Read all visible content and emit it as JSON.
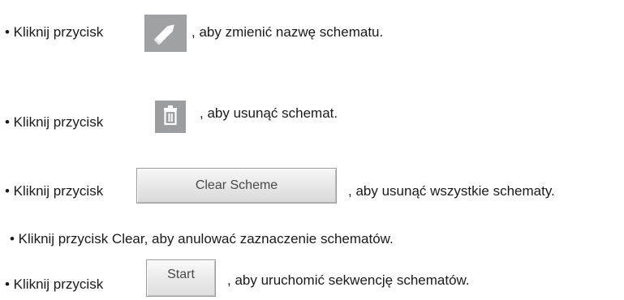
{
  "instructions": [
    {
      "prefix": "• Kliknij przycisk",
      "suffix": ", aby zmienić nazwę schematu.",
      "icon": "pencil-icon"
    },
    {
      "prefix": "• Kliknij przycisk",
      "suffix": ", aby usunąć schemat.",
      "icon": "trash-icon"
    },
    {
      "prefix": "• Kliknij przycisk",
      "button_label": "Clear Scheme",
      "suffix": ", aby usunąć wszystkie schematy."
    },
    {
      "text": "• Kliknij przycisk Clear, aby anulować zaznaczenie schematów."
    },
    {
      "prefix": "• Kliknij przycisk",
      "button_label": "Start",
      "suffix": ", aby uruchomić sekwencję schematów."
    }
  ],
  "colors": {
    "icon_button_bg": "#9fa1a3",
    "icon_glyph": "#ffffff",
    "text": "#1a1a1a"
  }
}
